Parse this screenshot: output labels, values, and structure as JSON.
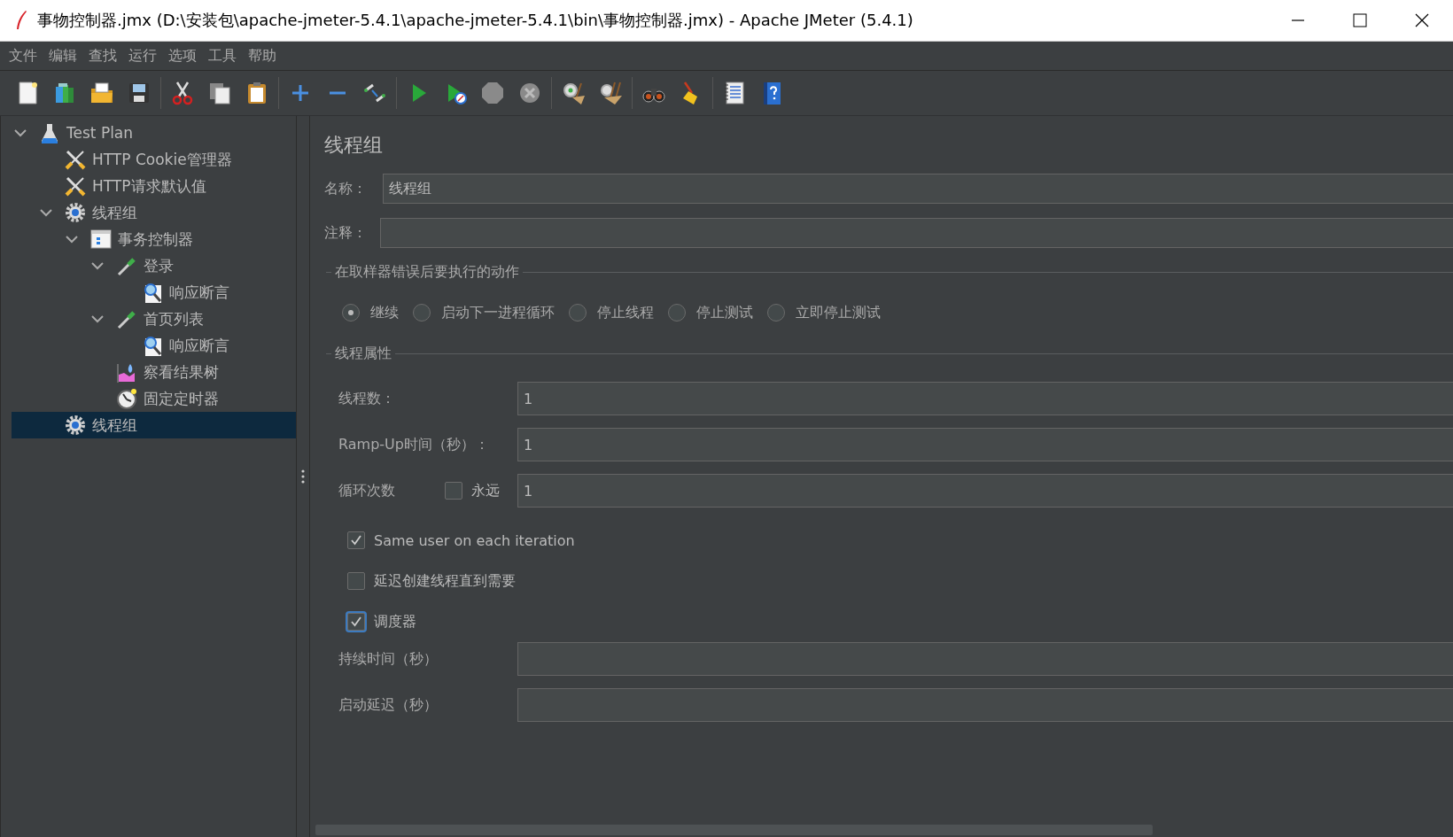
{
  "window": {
    "title": "事物控制器.jmx (D:\\安装包\\apache-jmeter-5.4.1\\apache-jmeter-5.4.1\\bin\\事物控制器.jmx) - Apache JMeter (5.4.1)"
  },
  "menu": [
    "文件",
    "编辑",
    "查找",
    "运行",
    "选项",
    "工具",
    "帮助"
  ],
  "tree": [
    {
      "label": "Test Plan",
      "kind": "plan",
      "expanded": true,
      "selected": false,
      "children": [
        {
          "label": "HTTP Cookie管理器",
          "kind": "config",
          "selected": false
        },
        {
          "label": "HTTP请求默认值",
          "kind": "config",
          "selected": false
        },
        {
          "label": "线程组",
          "kind": "thread-group",
          "expanded": true,
          "selected": false,
          "children": [
            {
              "label": "事务控制器",
              "kind": "controller",
              "expanded": true,
              "selected": false,
              "children": [
                {
                  "label": "登录",
                  "kind": "sampler",
                  "expanded": true,
                  "selected": false,
                  "children": [
                    {
                      "label": "响应断言",
                      "kind": "assertion",
                      "selected": false
                    }
                  ]
                },
                {
                  "label": "首页列表",
                  "kind": "sampler",
                  "expanded": true,
                  "selected": false,
                  "children": [
                    {
                      "label": "响应断言",
                      "kind": "assertion",
                      "selected": false
                    }
                  ]
                },
                {
                  "label": "察看结果树",
                  "kind": "listener",
                  "selected": false
                },
                {
                  "label": "固定定时器",
                  "kind": "timer",
                  "selected": false
                }
              ]
            }
          ]
        },
        {
          "label": "线程组",
          "kind": "thread-group",
          "selected": true
        }
      ]
    }
  ],
  "panel": {
    "title": "线程组",
    "name": {
      "label": "名称：",
      "value": "线程组"
    },
    "comment": {
      "label": "注释："
    }
  },
  "on_error": {
    "legend": "在取样器错误后要执行的动作",
    "options": [
      {
        "label": "继续",
        "selected": true
      },
      {
        "label": "启动下一进程循环",
        "selected": false
      },
      {
        "label": "停止线程",
        "selected": false
      },
      {
        "label": "停止测试",
        "selected": false
      },
      {
        "label": "立即停止测试",
        "selected": false
      }
    ]
  },
  "thread_properties": {
    "legend": "线程属性",
    "threads": {
      "label": "线程数：",
      "value": "1"
    },
    "ramp_up": {
      "label": "Ramp-Up时间（秒）：",
      "value": "1"
    },
    "loop": {
      "label": "循环次数",
      "forever": {
        "label": "永远",
        "checked": false
      },
      "value": "1"
    },
    "options": [
      {
        "label": "Same user on each iteration",
        "checked": true,
        "focused": false
      },
      {
        "label": "延迟创建线程直到需要",
        "checked": false,
        "focused": false
      },
      {
        "label": "调度器",
        "checked": true,
        "focused": true
      }
    ],
    "duration": {
      "label": "持续时间（秒）"
    },
    "startup_delay": {
      "label": "启动延迟（秒）"
    }
  }
}
